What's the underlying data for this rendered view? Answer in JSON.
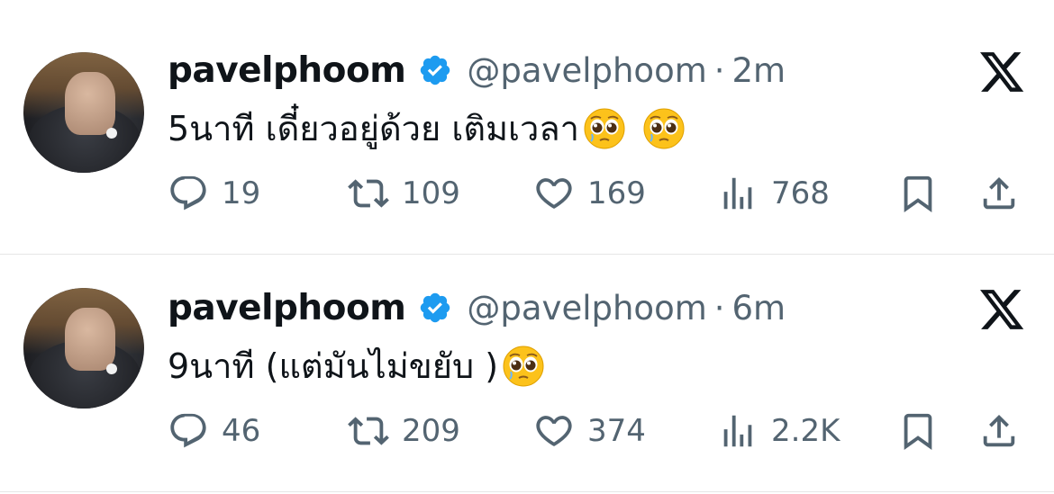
{
  "tweets": [
    {
      "name": "pavelphoom",
      "handle": "@pavelphoom",
      "separator": "·",
      "time": "2m",
      "text": "5นาที เดี๋ยวอยู่ด้วย เติมเวลา",
      "emojis": [
        "pleading-face",
        "pleading-face"
      ],
      "replies": "19",
      "retweets": "109",
      "likes": "169",
      "views": "768"
    },
    {
      "name": "pavelphoom",
      "handle": "@pavelphoom",
      "separator": "·",
      "time": "6m",
      "text": "9นาที (แต่มันไม่ขยับ )",
      "emojis": [
        "pleading-face"
      ],
      "replies": "46",
      "retweets": "209",
      "likes": "374",
      "views": "2.2K"
    }
  ],
  "icons": {
    "verified": "verified-badge-icon",
    "platform": "x-logo-icon",
    "reply": "reply-icon",
    "retweet": "retweet-icon",
    "like": "heart-icon",
    "views": "views-icon",
    "bookmark": "bookmark-icon",
    "share": "share-icon"
  },
  "colors": {
    "verified_blue": "#1d9bf0",
    "text_primary": "#0f1419",
    "text_secondary": "#536471",
    "divider": "#e6e6e6"
  }
}
